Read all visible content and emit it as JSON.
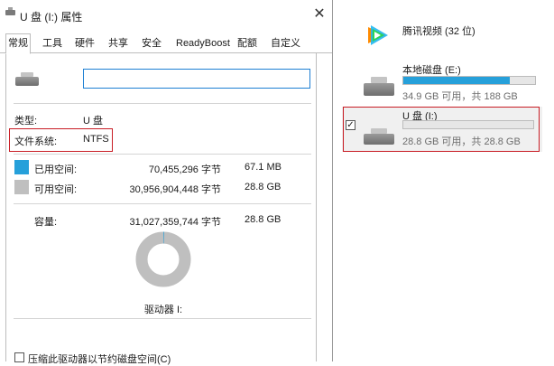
{
  "dialog": {
    "title": "U 盘 (I:) 属性",
    "close_glyph": "✕",
    "tabs": [
      "常规",
      "工具",
      "硬件",
      "共享",
      "安全",
      "ReadyBoost",
      "配额",
      "自定义"
    ],
    "active_tab": "常规",
    "name_value": "",
    "type_label": "类型:",
    "type_value": "U 盘",
    "fs_label": "文件系统:",
    "fs_value": "NTFS",
    "used_label": "已用空间:",
    "used_bytes": "70,455,296 字节",
    "used_size": "67.1 MB",
    "free_label": "可用空间:",
    "free_bytes": "30,956,904,448 字节",
    "free_size": "28.8 GB",
    "capacity_label": "容量:",
    "capacity_bytes": "31,027,359,744 字节",
    "capacity_size": "28.8 GB",
    "drive_label": "驱动器 I:",
    "compress_label": "压缩此驱动器以节约磁盘空间(C)",
    "used_fraction": 0.0023,
    "colors": {
      "used": "#26a0da",
      "free": "#bfbfbf",
      "highlight": "#c81d25"
    }
  },
  "this_pc": {
    "video_app": {
      "name": "腾讯视频 (32 位)",
      "icon": "tencent-video-icon"
    },
    "drives": [
      {
        "name": "本地磁盘 (E:)",
        "space": "34.9 GB 可用，共 188 GB",
        "used_fraction": 0.81,
        "icon": "hard-drive-icon"
      },
      {
        "name": "U 盘 (I:)",
        "space": "28.8 GB 可用，共 28.8 GB",
        "used_fraction": 0.0,
        "icon": "usb-drive-icon",
        "selected": true,
        "checked": true
      }
    ]
  }
}
